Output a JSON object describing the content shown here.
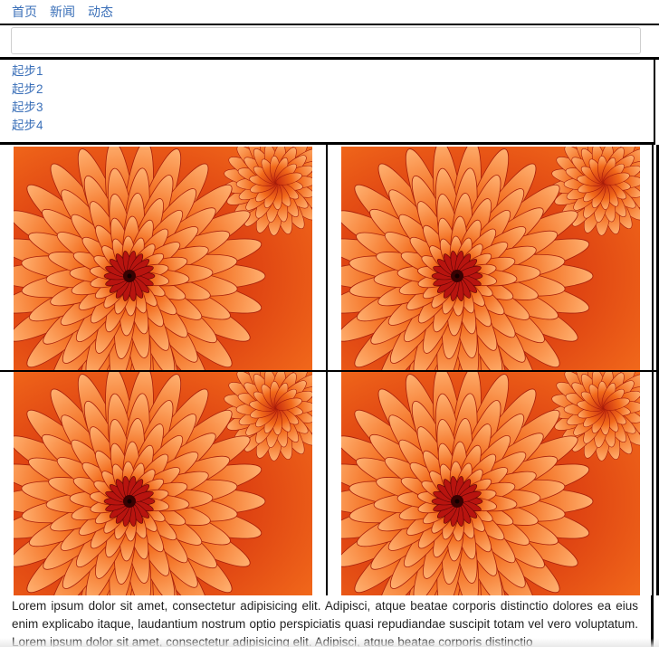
{
  "nav": {
    "items": [
      {
        "label": "首页"
      },
      {
        "label": "新闻"
      },
      {
        "label": "动态"
      }
    ]
  },
  "search": {
    "value": "",
    "placeholder": ""
  },
  "steps": {
    "items": [
      {
        "label": "起步1"
      },
      {
        "label": "起步2"
      },
      {
        "label": "起步3"
      },
      {
        "label": "起步4"
      }
    ]
  },
  "gallery": {
    "images": [
      {
        "subject": "orange-chrysanthemum-flower"
      },
      {
        "subject": "orange-chrysanthemum-flower"
      },
      {
        "subject": "orange-chrysanthemum-flower"
      },
      {
        "subject": "orange-chrysanthemum-flower"
      }
    ]
  },
  "content": {
    "paragraph": "Lorem ipsum dolor sit amet, consectetur adipisicing elit. Adipisci, atque beatae corporis distinctio dolores ea eius enim explicabo itaque, laudantium nostrum optio perspiciatis quasi repudiandae suscipit totam vel vero voluptatum. Lorem ipsum dolor sit amet, consectetur adipisicing elit. Adipisci, atque beatae corporis distinctio"
  },
  "colors": {
    "link": "#3a6fb8",
    "border": "#000000",
    "flower_outer": "#f26a1b",
    "flower_inner": "#b8140f"
  }
}
